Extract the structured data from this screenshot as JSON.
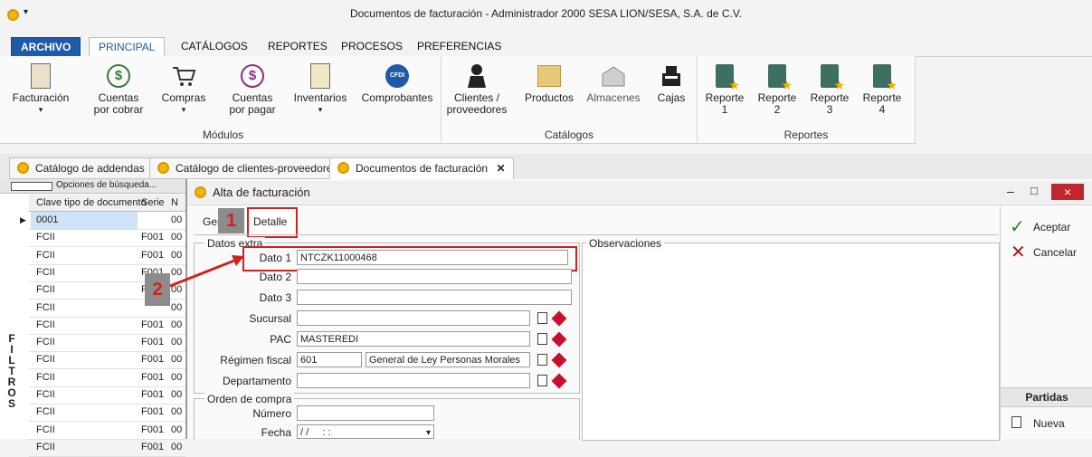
{
  "window": {
    "title": "Documentos de facturación - Administrador 2000 SESA LION/SESA, S.A. de C.V.",
    "qa_arrow": "▾"
  },
  "ribbon_tabs": [
    "ARCHIVO",
    "PRINCIPAL",
    "CATÁLOGOS",
    "REPORTES",
    "PROCESOS",
    "PREFERENCIAS"
  ],
  "ribbon": {
    "modulos": {
      "label": "Módulos",
      "items": [
        "Facturación",
        "Cuentas\npor cobrar",
        "Compras",
        "Cuentas\npor pagar",
        "Inventarios",
        "Comprobantes"
      ]
    },
    "catalogos": {
      "label": "Catálogos",
      "items": [
        "Clientes /\nproveedores",
        "Productos",
        "Almacenes",
        "Cajas"
      ]
    },
    "reportes": {
      "label": "Reportes",
      "items": [
        "Reporte\n1",
        "Reporte\n2",
        "Reporte\n3",
        "Reporte\n4"
      ]
    },
    "dropdown_arrow": "▾",
    "icons": {
      "cuentas_cobrar": "$",
      "cuentas_pagar": "$",
      "comprobantes": "CFDI"
    }
  },
  "doc_tabs": [
    "Catálogo de addendas",
    "Catálogo de clientes-proveedores",
    "Documentos de facturación"
  ],
  "doc_tab_close": "✕",
  "left_panel": {
    "search_label": "Opciones de búsqueda...",
    "columns": [
      "Clave tipo de documento",
      "Serie",
      "N"
    ],
    "rows": [
      {
        "clave": "0001",
        "serie": "",
        "n": "00"
      },
      {
        "clave": "FCII",
        "serie": "F001",
        "n": "00"
      },
      {
        "clave": "FCII",
        "serie": "F001",
        "n": "00"
      },
      {
        "clave": "FCII",
        "serie": "F001",
        "n": "00"
      },
      {
        "clave": "FCII",
        "serie": "F001",
        "n": "00"
      },
      {
        "clave": "FCII",
        "serie": "",
        "n": "00"
      },
      {
        "clave": "FCII",
        "serie": "F001",
        "n": "00"
      },
      {
        "clave": "FCII",
        "serie": "F001",
        "n": "00"
      },
      {
        "clave": "FCII",
        "serie": "F001",
        "n": "00"
      },
      {
        "clave": "FCII",
        "serie": "F001",
        "n": "00"
      },
      {
        "clave": "FCII",
        "serie": "F001",
        "n": "00"
      },
      {
        "clave": "FCII",
        "serie": "F001",
        "n": "00"
      },
      {
        "clave": "FCII",
        "serie": "F001",
        "n": "00"
      },
      {
        "clave": "FCII",
        "serie": "F001",
        "n": "00"
      }
    ],
    "filtros": "FILTROS"
  },
  "dialog": {
    "title": "Alta de facturación",
    "tabs": [
      "Gen",
      "Detalle"
    ],
    "datos_extra_label": "Datos extra",
    "observaciones_label": "Observaciones",
    "fields": {
      "dato1": {
        "label": "Dato 1",
        "value": "NTCZK11000468"
      },
      "dato2": {
        "label": "Dato 2",
        "value": ""
      },
      "dato3": {
        "label": "Dato 3",
        "value": ""
      },
      "sucursal": {
        "label": "Sucursal",
        "value": ""
      },
      "pac": {
        "label": "PAC",
        "value": "MASTEREDI"
      },
      "regimen": {
        "label": "Régimen fiscal",
        "code": "601",
        "desc": "General de Ley Personas Morales"
      },
      "departamento": {
        "label": "Departamento",
        "value": ""
      }
    },
    "orden_compra": {
      "label": "Orden de compra",
      "numero_label": "Número",
      "numero_value": "",
      "fecha_label": "Fecha",
      "fecha_value": "/ /     : :"
    },
    "buttons": {
      "aceptar": "Aceptar",
      "cancelar": "Cancelar",
      "partidas": "Partidas",
      "nueva": "Nueva"
    },
    "window_controls": {
      "minimize": "–",
      "maximize": "□",
      "close": "×"
    }
  },
  "annotations": {
    "one": "1",
    "two": "2"
  },
  "colors": {
    "accent": "#1f5aa8",
    "highlight": "#d0211c"
  }
}
